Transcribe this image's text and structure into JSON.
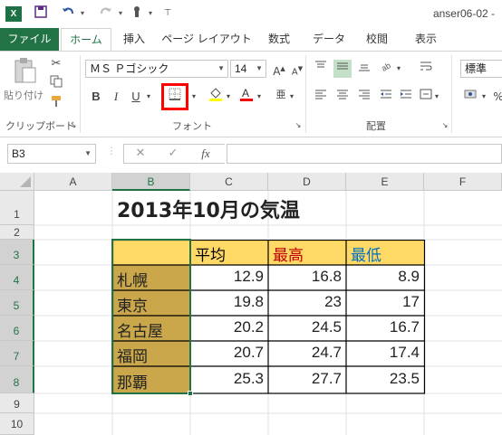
{
  "window": {
    "title": "anser06-02 -"
  },
  "quick_access": {
    "save_icon": "save-icon",
    "undo_icon": "undo-icon",
    "redo_icon": "redo-icon",
    "touch_icon": "touch-mode-icon"
  },
  "tabs": [
    {
      "label": "ファイル"
    },
    {
      "label": "ホーム"
    },
    {
      "label": "挿入"
    },
    {
      "label": "ページ レイアウト"
    },
    {
      "label": "数式"
    },
    {
      "label": "データ"
    },
    {
      "label": "校閲"
    },
    {
      "label": "表示"
    }
  ],
  "ribbon": {
    "clipboard": {
      "paste_label": "貼り付け",
      "group_label": "クリップボード"
    },
    "font": {
      "font_name": "ＭＳ Ｐゴシック",
      "font_size": "14",
      "bold": "B",
      "italic": "I",
      "underline": "U",
      "group_label": "フォント"
    },
    "alignment": {
      "group_label": "配置"
    },
    "number": {
      "format": "標準"
    }
  },
  "formula_bar": {
    "name_box": "B3",
    "cancel": "✕",
    "enter": "✓",
    "fx": "fx",
    "value": ""
  },
  "columns": [
    "A",
    "B",
    "C",
    "D",
    "E",
    "F"
  ],
  "rows": [
    "1",
    "2",
    "3",
    "4",
    "5",
    "6",
    "7",
    "8",
    "9",
    "10"
  ],
  "sheet": {
    "title": "2013年10月の気温",
    "headers": [
      "平均",
      "最高",
      "最低"
    ],
    "header_colors": [
      "#000000",
      "#c00000",
      "#0070c0"
    ],
    "cities": [
      "札幌",
      "東京",
      "名古屋",
      "福岡",
      "那覇"
    ],
    "data": [
      [
        "12.9",
        "16.8",
        "8.9"
      ],
      [
        "19.8",
        "23",
        "17"
      ],
      [
        "20.2",
        "24.5",
        "16.7"
      ],
      [
        "20.7",
        "24.7",
        "17.4"
      ],
      [
        "25.3",
        "27.7",
        "23.5"
      ]
    ]
  },
  "colors": {
    "accent": "#217346",
    "header_fill": "#ffd966",
    "city_fill": "#c9a74a",
    "highlight": "#ff0000"
  }
}
